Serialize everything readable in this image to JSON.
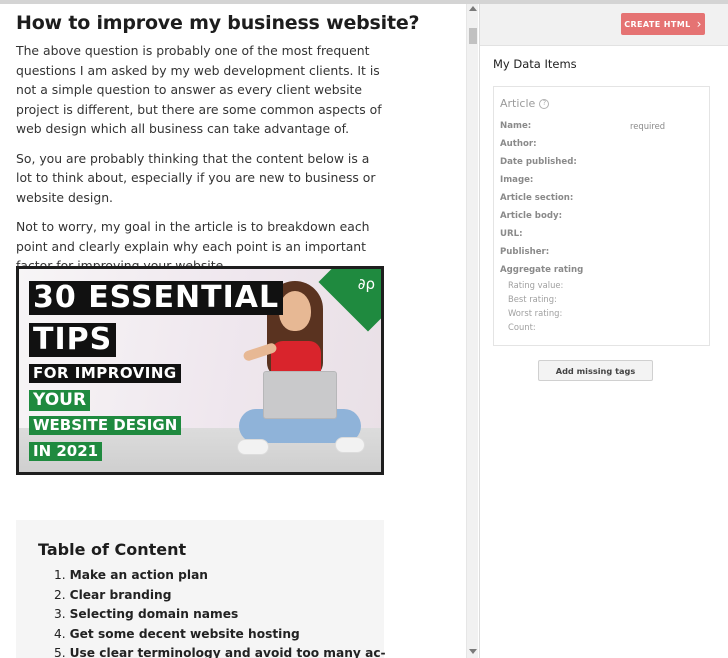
{
  "article": {
    "title": "How to improve my business website?",
    "paragraphs": [
      "The above question is probably one of the most frequent questions I am asked by my web development clients. It is not a simple question to answer as every client website project is different, but there are some common aspects of web design which all business can take advantage of.",
      "So, you are probably thinking that the content below is a lot to think about, especially if you are new to business or website design.",
      "Not to worry, my goal in the article is to breakdown each point and clearly explain why each point is an important factor for improving your website."
    ],
    "hero": {
      "lines": [
        "30 ESSENTIAL",
        "TIPS",
        "FOR IMPROVING",
        "YOUR",
        "WEBSITE DESIGN",
        "IN 2021"
      ],
      "accent_color": "#1f8a3f",
      "dark_color": "#111111"
    },
    "toc": {
      "title": "Table of Content",
      "items": [
        {
          "num": "1.",
          "text": "Make an action plan"
        },
        {
          "num": "2.",
          "text": "Clear branding"
        },
        {
          "num": "3.",
          "text": "Selecting domain names"
        },
        {
          "num": "4.",
          "text": "Get some decent website hosting"
        },
        {
          "num": "5.",
          "text": "Use clear terminology and avoid too many ac-"
        }
      ]
    }
  },
  "panel": {
    "create_button": "CREATE HTML",
    "create_button_color": "#e57373",
    "title": "My Data Items",
    "item_type": "Article",
    "required_note": "required",
    "properties": [
      "Name:",
      "Author:",
      "Date published:",
      "Image:",
      "Article section:",
      "Article body:",
      "URL:",
      "Publisher:",
      "Aggregate rating"
    ],
    "sub_properties": [
      "Rating value:",
      "Best rating:",
      "Worst rating:",
      "Count:"
    ],
    "add_button": "Add missing tags"
  }
}
